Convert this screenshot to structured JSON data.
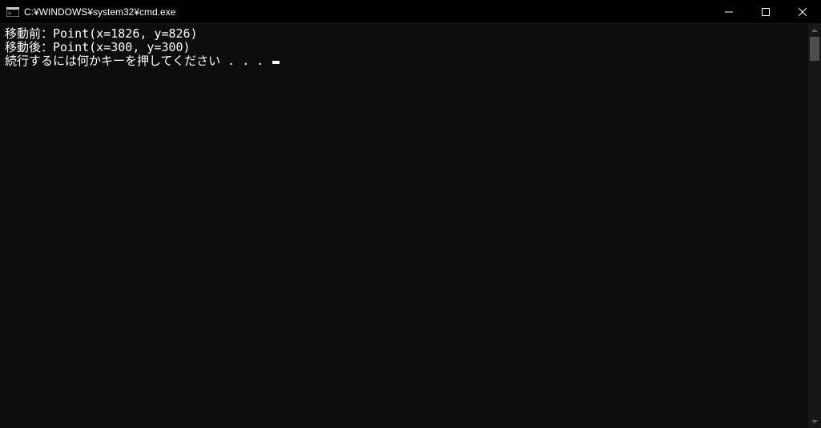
{
  "window": {
    "title": "C:¥WINDOWS¥system32¥cmd.exe"
  },
  "output": {
    "line1": "移動前：Point(x=1826, y=826)",
    "line2": "移動後：Point(x=300, y=300)",
    "line3": "続行するには何かキーを押してください . . . "
  }
}
